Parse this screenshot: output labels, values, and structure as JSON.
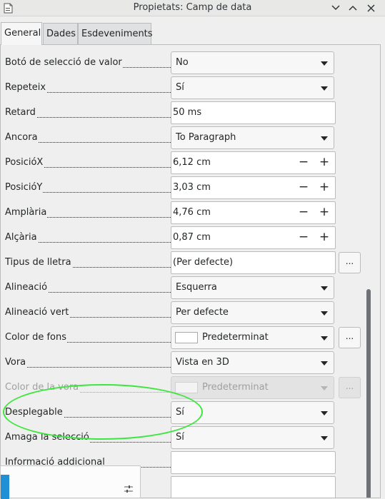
{
  "window": {
    "title": "Propietats: Camp de data",
    "icons": {
      "app": "document-icon",
      "minimize": "chevron-down-icon",
      "maximize": "chevron-up-icon",
      "close": "close-icon"
    }
  },
  "tabs": [
    {
      "label": "General",
      "active": true
    },
    {
      "label": "Dades",
      "active": false
    },
    {
      "label": "Esdeveniments",
      "active": false
    }
  ],
  "properties": [
    {
      "label": "Botó de selecció de valor",
      "type": "combo",
      "value": "No"
    },
    {
      "label": "Repeteix",
      "type": "combo",
      "value": "Sí"
    },
    {
      "label": "Retard",
      "type": "text",
      "value": "50 ms"
    },
    {
      "label": "Àncora",
      "type": "combo",
      "value": "To Paragraph"
    },
    {
      "label": "PosicióX",
      "type": "spin",
      "value": "6,12 cm"
    },
    {
      "label": "PosicióY",
      "type": "spin",
      "value": "3,03 cm"
    },
    {
      "label": "Amplària",
      "type": "spin",
      "value": "4,76 cm"
    },
    {
      "label": "Alçària",
      "type": "spin",
      "value": "0,87 cm"
    },
    {
      "label": "Tipus de lletra",
      "type": "text-button",
      "value": "(Per defecte)",
      "button": "..."
    },
    {
      "label": "Alineació",
      "type": "combo",
      "value": "Esquerra"
    },
    {
      "label": "Alineació vert",
      "type": "combo",
      "value": "Per defecte"
    },
    {
      "label": "Color de fons",
      "type": "color",
      "value": "Predeterminat",
      "button": "..."
    },
    {
      "label": "Vora",
      "type": "combo",
      "value": "Vista en 3D"
    },
    {
      "label": "Color de la vora",
      "type": "color",
      "value": "Predeterminat",
      "button": "...",
      "disabled": true
    },
    {
      "label": "Desplegable",
      "type": "combo",
      "value": "Sí"
    },
    {
      "label": "Amaga la selecció",
      "type": "combo",
      "value": "Sí"
    },
    {
      "label": "Informació addicional",
      "type": "text",
      "value": ""
    }
  ],
  "colors": {
    "highlight_circle": "#3ce63c",
    "taskbar_accent": "#1f8fd6"
  }
}
